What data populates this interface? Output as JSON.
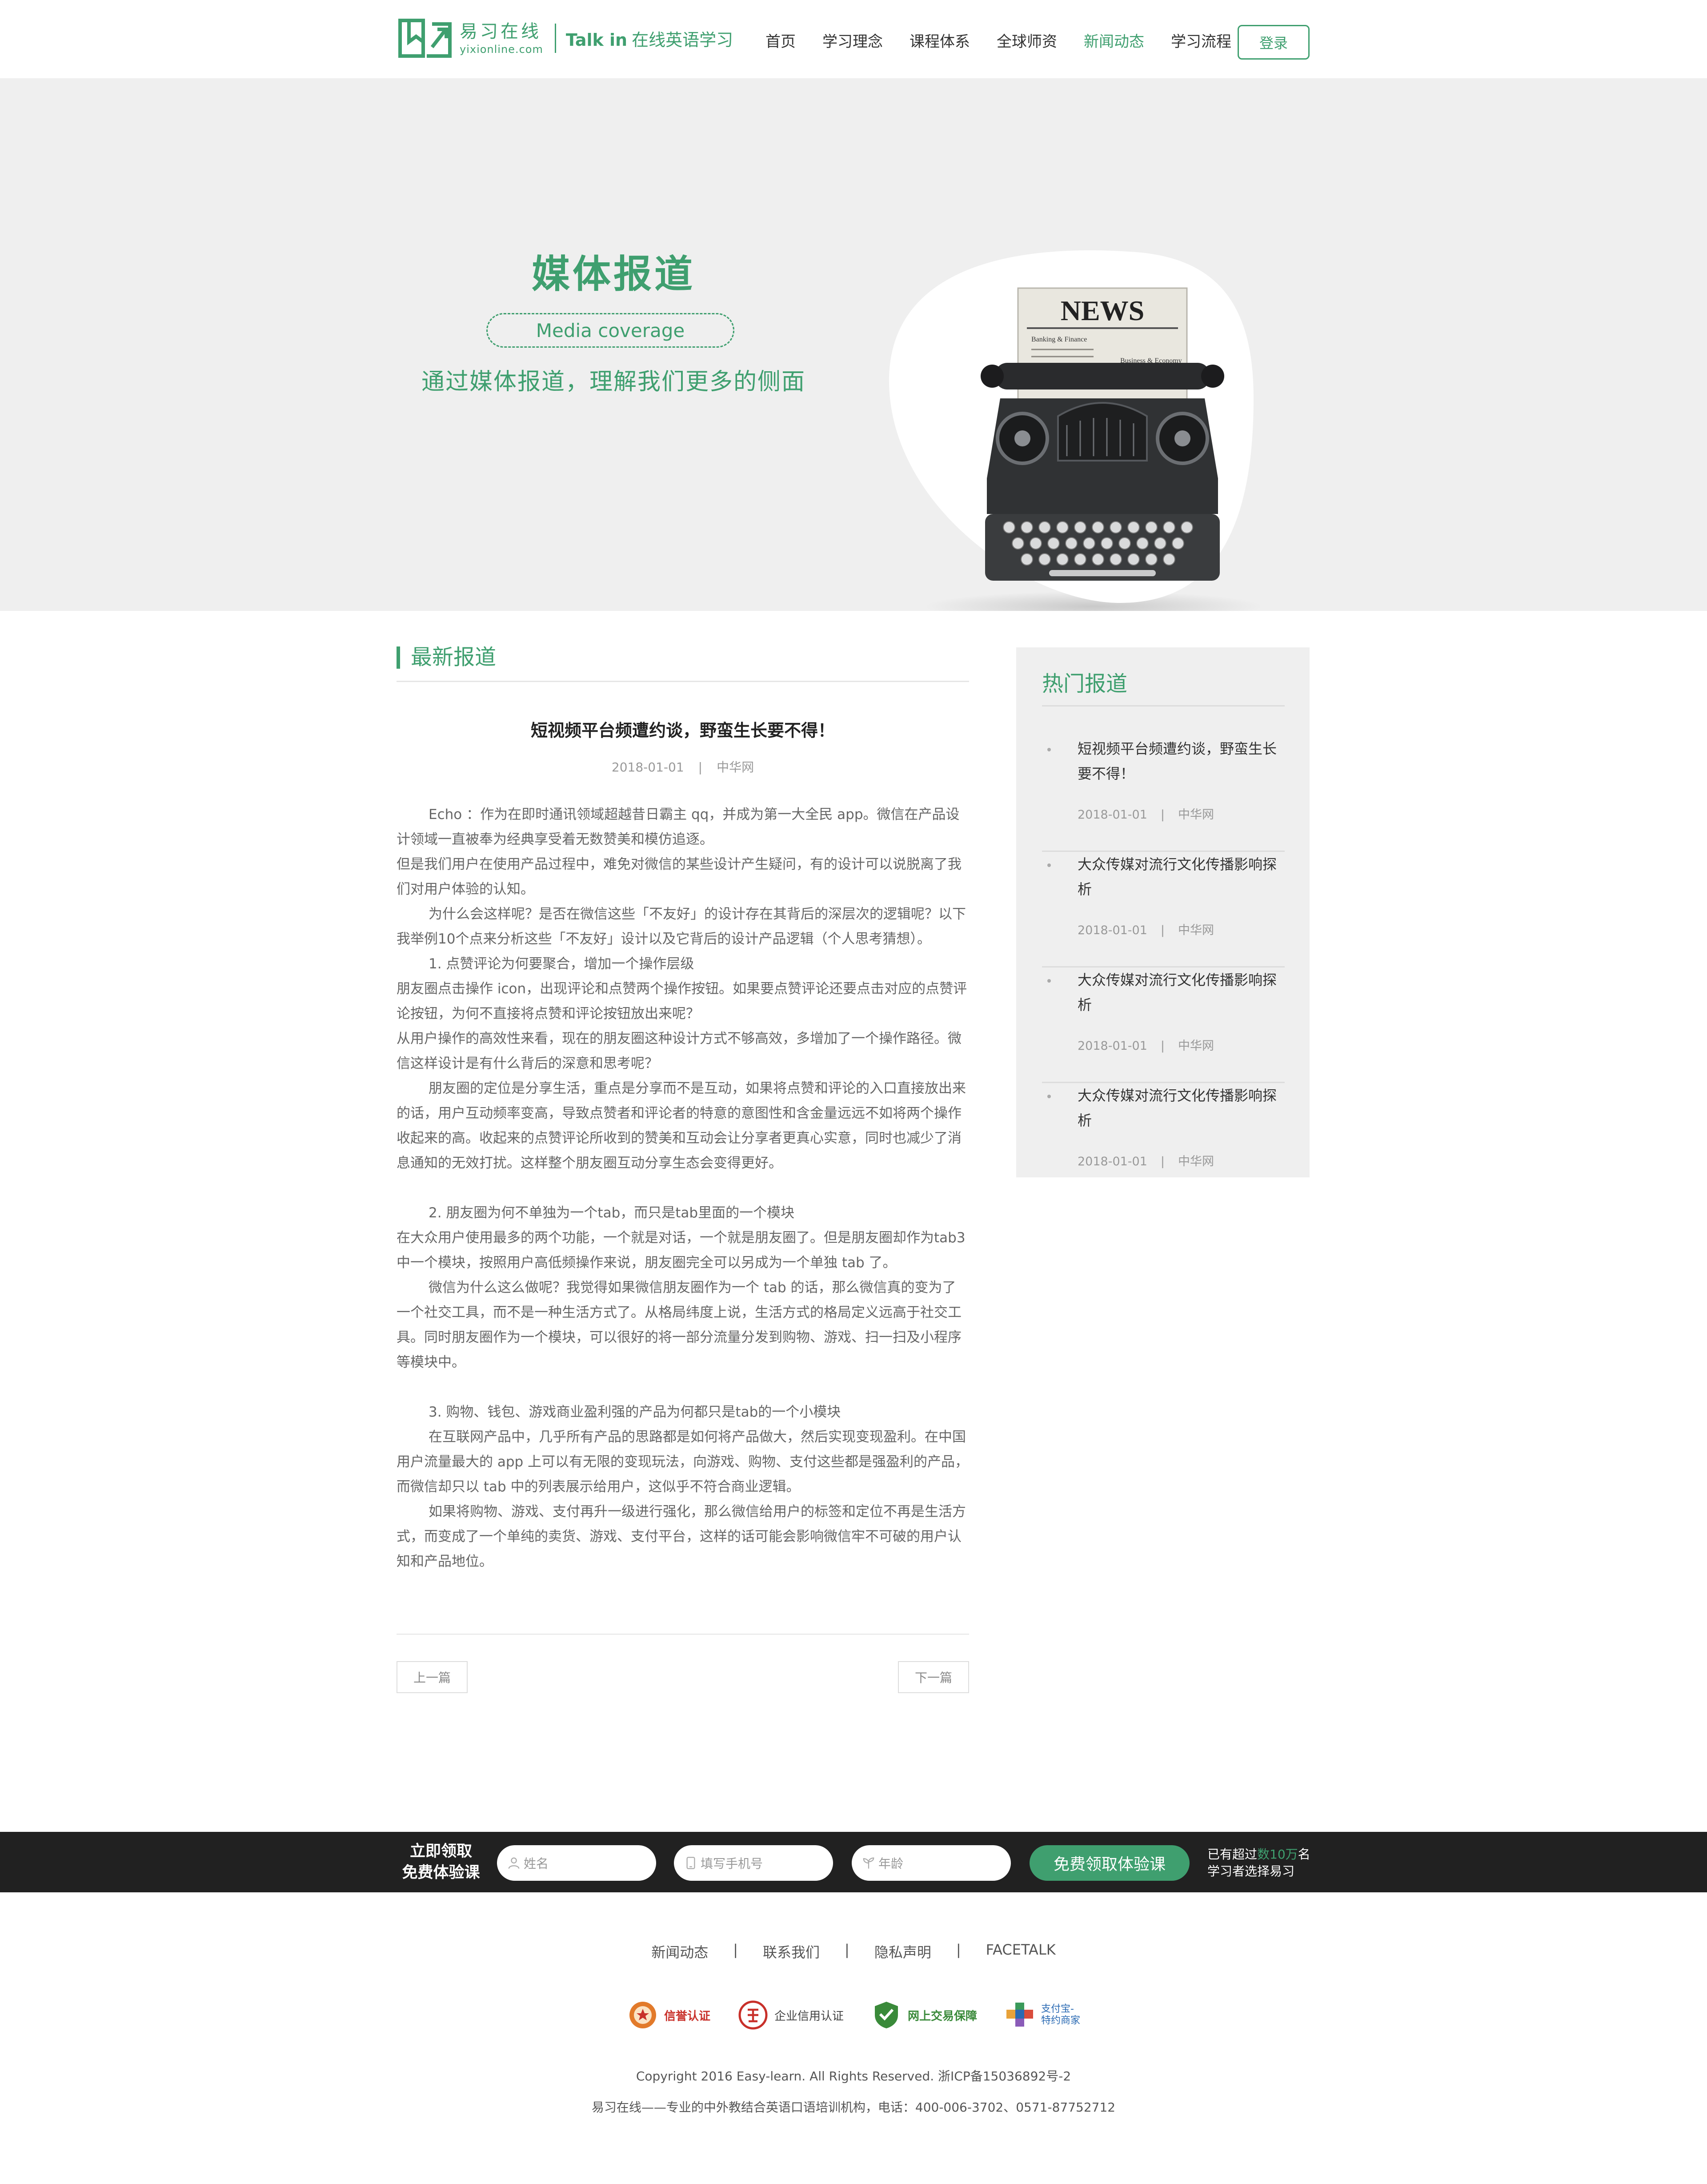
{
  "brand": {
    "cn": "易习在线",
    "domain": "yixionline.com",
    "slogan_bold": "Talk in",
    "slogan_rest": "在线英语学习",
    "color": "#3f9f6f"
  },
  "nav": {
    "items": [
      "首页",
      "学习理念",
      "课程体系",
      "全球师资",
      "新闻动态",
      "学习流程"
    ],
    "active": "新闻动态",
    "login": "登录"
  },
  "banner": {
    "title": "媒体报道",
    "pill": "Media coverage",
    "subtitle": "通过媒体报道，理解我们更多的侧面",
    "art_text": "NEWS",
    "art_small_1": "Banking & Finance",
    "art_small_2": "Business & Economy"
  },
  "latest": {
    "heading": "最新报道",
    "article": {
      "title": "短视频平台频遭约谈，野蛮生长要不得！",
      "date": "2018-01-01",
      "sep": "|",
      "source": "中华网",
      "paragraphs": [
        {
          "text": "Echo ：作为在即时通讯领域超越昔日霸主 qq，并成为第一大全民 app。微信在产品设计领域一直被奉为经典享受着无数赞美和模仿追逐。",
          "indent": true,
          "gap": false
        },
        {
          "text": "但是我们用户在使用产品过程中，难免对微信的某些设计产生疑问，有的设计可以说脱离了我们对用户体验的认知。",
          "indent": false,
          "gap": false
        },
        {
          "text": "为什么会这样呢？是否在微信这些「不友好」的设计存在其背后的深层次的逻辑呢？以下我举例10个点来分析这些「不友好」设计以及它背后的设计产品逻辑（个人思考猜想）。",
          "indent": true,
          "gap": false
        },
        {
          "text": "1. 点赞评论为何要聚合，增加一个操作层级",
          "indent": true,
          "gap": false
        },
        {
          "text": "朋友圈点击操作 icon，出现评论和点赞两个操作按钮。如果要点赞评论还要点击对应的点赞评论按钮，为何不直接将点赞和评论按钮放出来呢？",
          "indent": false,
          "gap": false
        },
        {
          "text": "从用户操作的高效性来看，现在的朋友圈这种设计方式不够高效，多增加了一个操作路径。微信这样设计是有什么背后的深意和思考呢？",
          "indent": false,
          "gap": false
        },
        {
          "text": "朋友圈的定位是分享生活，重点是分享而不是互动，如果将点赞和评论的入口直接放出来的话，用户互动频率变高，导致点赞者和评论者的特意的意图性和含金量远远不如将两个操作收起来的高。收起来的点赞评论所收到的赞美和互动会让分享者更真心实意，同时也减少了消息通知的无效打扰。这样整个朋友圈互动分享生态会变得更好。",
          "indent": true,
          "gap": false
        },
        {
          "text": "2. 朋友圈为何不单独为一个tab，而只是tab里面的一个模块",
          "indent": true,
          "gap": true
        },
        {
          "text": "在大众用户使用最多的两个功能，一个就是对话，一个就是朋友圈了。但是朋友圈却作为tab3 中一个模块，按照用户高低频操作来说，朋友圈完全可以另成为一个单独 tab 了。",
          "indent": false,
          "gap": false
        },
        {
          "text": "微信为什么这么做呢？我觉得如果微信朋友圈作为一个 tab 的话，那么微信真的变为了一个社交工具，而不是一种生活方式了。从格局纬度上说，生活方式的格局定义远高于社交工具。同时朋友圈作为一个模块，可以很好的将一部分流量分发到购物、游戏、扫一扫及小程序等模块中。",
          "indent": true,
          "gap": false
        },
        {
          "text": "3. 购物、钱包、游戏商业盈利强的产品为何都只是tab的一个小模块",
          "indent": true,
          "gap": true
        },
        {
          "text": "在互联网产品中，几乎所有产品的思路都是如何将产品做大，然后实现变现盈利。在中国用户流量最大的 app 上可以有无限的变现玩法，向游戏、购物、支付这些都是强盈利的产品，而微信却只以 tab 中的列表展示给用户，这似乎不符合商业逻辑。",
          "indent": true,
          "gap": false
        },
        {
          "text": "如果将购物、游戏、支付再升一级进行强化，那么微信给用户的标签和定位不再是生活方式，而变成了一个单纯的卖货、游戏、支付平台，这样的话可能会影响微信牢不可破的用户认知和产品地位。",
          "indent": true,
          "gap": false
        }
      ]
    },
    "prev": "上一篇",
    "next": "下一篇"
  },
  "hot": {
    "heading": "热门报道",
    "items": [
      {
        "title": "短视频平台频遭约谈，野蛮生长要不得！",
        "date": "2018-01-01",
        "sep": "|",
        "source": "中华网"
      },
      {
        "title": "大众传媒对流行文化传播影响探析",
        "date": "2018-01-01",
        "sep": "|",
        "source": "中华网"
      },
      {
        "title": "大众传媒对流行文化传播影响探析",
        "date": "2018-01-01",
        "sep": "|",
        "source": "中华网"
      },
      {
        "title": "大众传媒对流行文化传播影响探析",
        "date": "2018-01-01",
        "sep": "|",
        "source": "中华网"
      }
    ]
  },
  "trial": {
    "label_line1": "立即领取",
    "label_line2": "免费体验课",
    "name_placeholder": "姓名",
    "phone_placeholder": "填写手机号",
    "age_placeholder": "年龄",
    "button": "免费领取体验课",
    "note_pre": "已有超过",
    "note_highlight": "数10万",
    "note_post": "名",
    "note_line2": "学习者选择易习"
  },
  "footer": {
    "links": [
      "新闻动态",
      "联系我们",
      "隐私声明",
      "FACETALK"
    ],
    "link_sep": "|",
    "badges": [
      {
        "icon": "medal-icon",
        "text": "信誉认证"
      },
      {
        "icon": "credit-icon",
        "text": "企业信用认证"
      },
      {
        "icon": "shield-icon",
        "text": "网上交易保障"
      },
      {
        "icon": "puzzle-icon",
        "text_line1": "支付宝-",
        "text_line2": "特约商家"
      }
    ],
    "copyright": "Copyright 2016 Easy-learn. All Rights Reserved. 浙ICP备15036892号-2",
    "contact": "易习在线——专业的中外教结合英语口语培训机构，电话：400-006-3702、0571-87752712"
  }
}
